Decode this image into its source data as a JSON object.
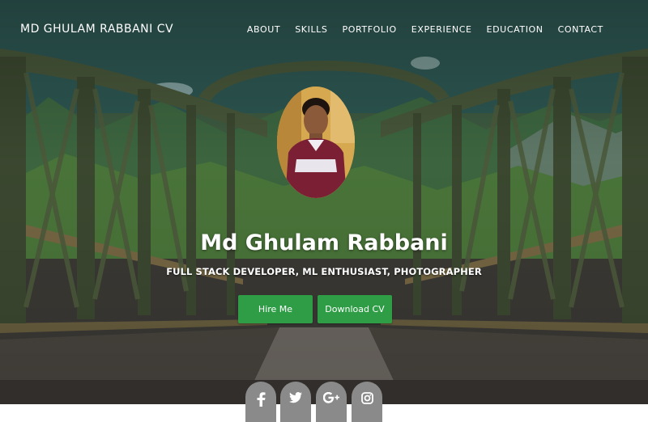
{
  "header": {
    "brand": "MD GHULAM RABBANI CV",
    "nav": [
      "ABOUT",
      "SKILLS",
      "PORTFOLIO",
      "EXPERIENCE",
      "EDUCATION",
      "CONTACT"
    ]
  },
  "hero": {
    "name": "Md Ghulam Rabbani",
    "tagline": "FULL STACK DEVELOPER, ML ENTHUSIAST, PHOTOGRAPHER",
    "hire_label": "Hire Me",
    "download_label": "Download CV"
  },
  "social": {
    "icons": [
      "facebook-icon",
      "twitter-icon",
      "google-plus-icon",
      "instagram-icon"
    ]
  },
  "colors": {
    "button": "#2e9d46",
    "social": "#8a8a8a",
    "text": "#ffffff"
  }
}
